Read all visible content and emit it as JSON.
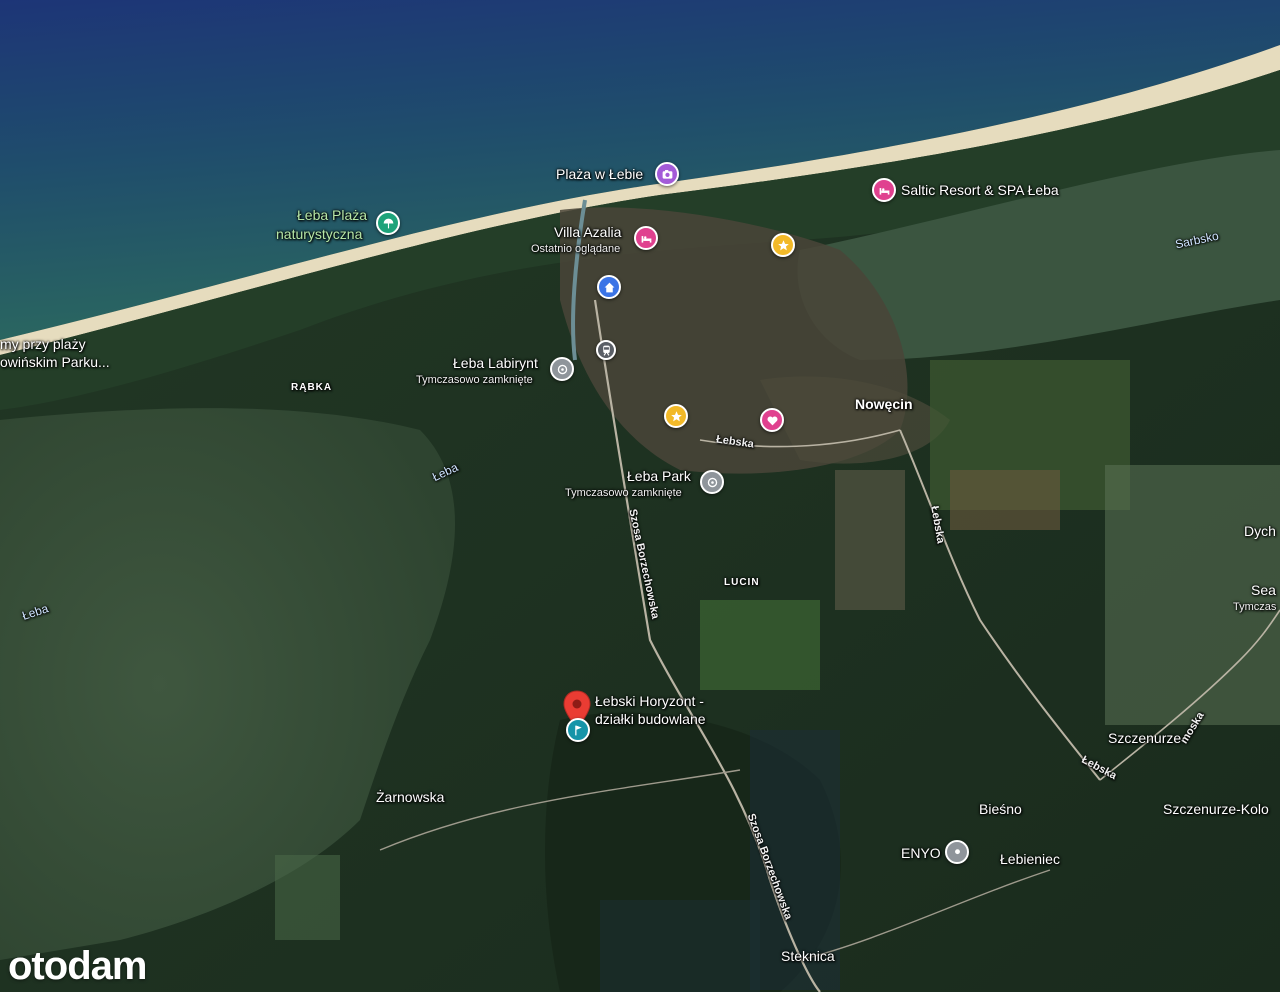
{
  "colors": {
    "sea_deep": "#1d3d78",
    "sea_shallow": "#2c6a5e",
    "beach": "#e8dfc2",
    "forest": "#1e3221",
    "lagoon": "#3a4f3c",
    "pin_purple": "#a35bd8",
    "pin_pink": "#e0418f",
    "pin_green": "#1ea37a",
    "pin_yellow": "#f2b928",
    "pin_blue": "#3b74e6",
    "pin_gray": "#8f959b",
    "pin_red": "#ea3c33",
    "pin_teal": "#1594a8"
  },
  "labels": {
    "plaza_lebie": "Plaża w Łebie",
    "saltic": "Saltic Resort & SPA Łeba",
    "sarbsko": "Sarbsko",
    "leba_plaza_1": "Łeba Plaża",
    "leba_plaza_2": "naturystyczna",
    "villa_azalia": "Villa Azalia",
    "villa_sub": "Ostatnio oglądane",
    "plaza_left_1": "my przy plaży",
    "plaza_left_2": "owińskim Parku...",
    "rabka": "RĄBKA",
    "labirynt": "Łeba Labirynt",
    "labirynt_sub": "Tymczasowo zamknięte",
    "nowecin": "Nowęcin",
    "lebska_1": "Łebska",
    "leba_water_1": "Łeba",
    "leba_park": "Łeba Park",
    "leba_park_sub": "Tymczasowo zamknięte",
    "szosa_1": "Szosa Borzechowska",
    "lebska_2": "Łebska",
    "lucin": "LUCIN",
    "leba_water_2": "Łeba",
    "dych": "Dych",
    "sea_right": "Sea",
    "sea_right_sub": "Tymczas",
    "horyzont_1": "Łebski Horyzont -",
    "horyzont_2": "działki budowlane",
    "moska": "moska",
    "szczenurze": "Szczenurze",
    "lebska_3": "Łebska",
    "zarnowska": "Żarnowska",
    "biesno": "Bieśno",
    "szczenurze_kolo": "Szczenurze-Kolo",
    "enyo": "ENYO",
    "lebieniec": "Łebieniec",
    "szosa_2": "Szosa Borzechowska",
    "steknica": "Steknica"
  },
  "icons": {
    "plaza": "camera-icon",
    "saltic": "bed-icon",
    "villa": "bed-icon",
    "naturist": "beach-umbrella-icon",
    "star": "star-icon",
    "home": "home-icon",
    "train": "train-icon",
    "labirynt": "attraction-icon",
    "heart": "heart-icon",
    "park": "attraction-icon",
    "horyzont": "flag-icon",
    "enyo": "location-pin-icon"
  },
  "logo": "otodam"
}
